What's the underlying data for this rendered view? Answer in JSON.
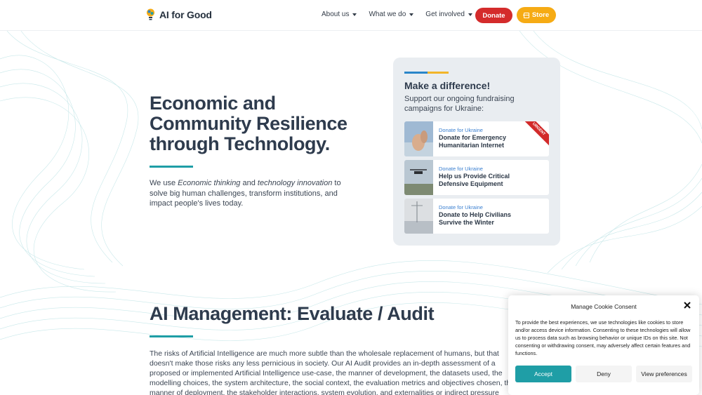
{
  "header": {
    "logo_text": "AI for Good",
    "nav": [
      "About us",
      "What we do",
      "Get involved"
    ],
    "donate_label": "Donate",
    "store_label": "Store"
  },
  "hero": {
    "title": "Economic and Community Resilience through Technology.",
    "text_before": "We use ",
    "text_em1": "Economic thinking",
    "text_mid": " and ",
    "text_em2": "technology innovation",
    "text_after": " to solve big human challenges, transform institutions, and impact people's lives today."
  },
  "fundraising": {
    "title": "Make a difference!",
    "subtitle": "Support our ongoing fundraising campaigns for Ukraine:",
    "items": [
      {
        "tag": "Donate for Ukraine",
        "name": "Donate for Emergency Humanitarian Internet",
        "badge": "URGENT"
      },
      {
        "tag": "Donate for Ukraine",
        "name": "Help us Provide Critical Defensive Equipment"
      },
      {
        "tag": "Donate for Ukraine",
        "name": "Donate to Help Civilians Survive the Winter"
      }
    ]
  },
  "section2": {
    "title": "AI Management: Evaluate / Audit",
    "text": "The risks of Artificial Intelligence are much more subtle than the wholesale replacement of humans, but that doesn't make those risks any less pernicious in society. Our AI Audit provides an in-depth assessment of a proposed or implemented Artificial Intelligence use-case, the manner of development, the datasets used, the modelling choices, the system architecture, the social context, the evaluation metrics and objectives chosen, the manner of deployment, the stakeholder interactions, system evolution, and externalities or indirect pressure"
  },
  "cookie": {
    "title": "Manage Cookie Consent",
    "text": "To provide the best experiences, we use technologies like cookies to store and/or access device information. Consenting to these technologies will allow us to process data such as browsing behavior or unique IDs on this site. Not consenting or withdrawing consent, may adversely affect certain features and functions.",
    "accept": "Accept",
    "deny": "Deny",
    "preferences": "View preferences"
  },
  "colors": {
    "accent_teal": "#1f9ea6",
    "donate_red": "#d42b2b",
    "store_orange": "#f6ab14",
    "ukraine_blue": "#2a86c9",
    "ukraine_yellow": "#f2b52a"
  }
}
